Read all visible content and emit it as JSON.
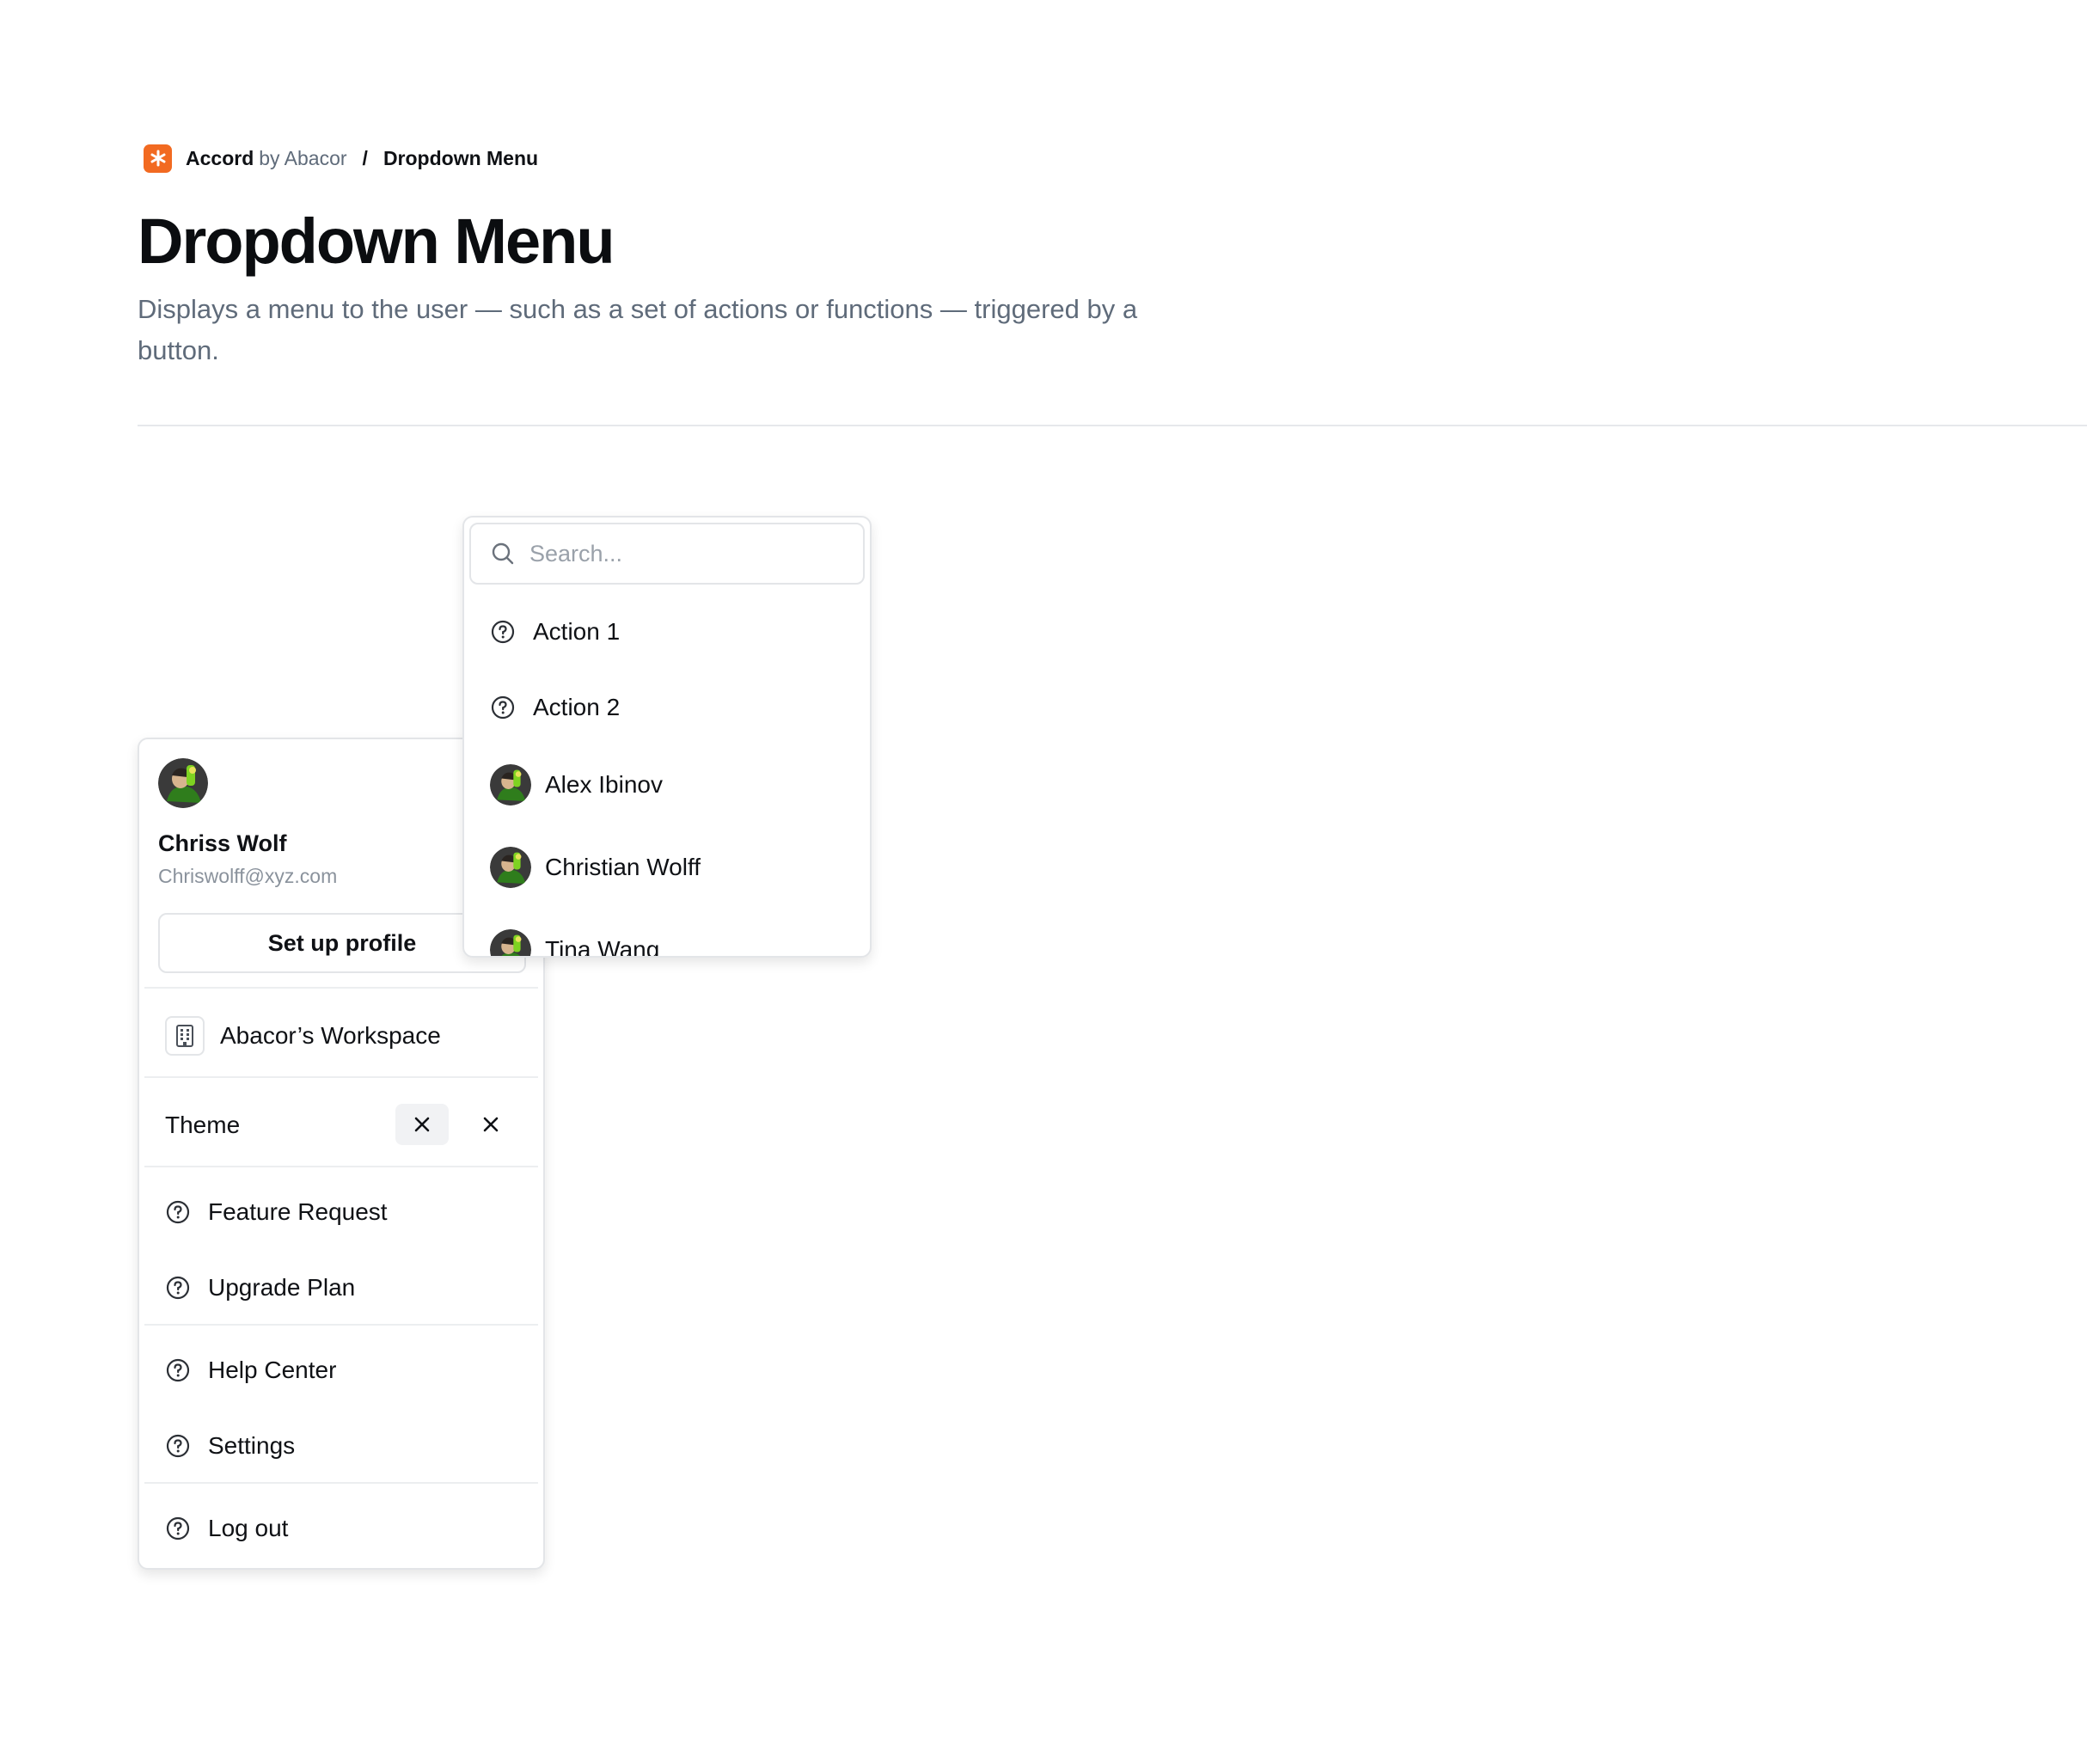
{
  "breadcrumb": {
    "brand": "Accord",
    "by": "by Abacor",
    "separator": "/",
    "current": "Dropdown Menu"
  },
  "page": {
    "title": "Dropdown Menu",
    "description": "Displays a menu to the user — such as a set of actions or functions — triggered by a button."
  },
  "account_menu": {
    "user_name": "Chriss Wolf",
    "user_email": "Chriswolff@xyz.com",
    "setup_button": "Set up profile",
    "workspace": "Abacor’s Workspace",
    "theme_label": "Theme",
    "items": [
      {
        "label": "Feature Request"
      },
      {
        "label": "Upgrade Plan"
      },
      {
        "label": "Help Center"
      },
      {
        "label": "Settings"
      },
      {
        "label": "Log out"
      }
    ]
  },
  "search_menu": {
    "placeholder": "Search...",
    "actions": [
      {
        "label": "Action 1"
      },
      {
        "label": "Action 2"
      }
    ],
    "people": [
      {
        "name": "Alex Ibinov"
      },
      {
        "name": "Christian Wolff"
      },
      {
        "name": "Tina Wang"
      }
    ]
  },
  "colors": {
    "brand_orange": "#f26a21",
    "text_primary": "#0f1115",
    "text_muted": "#5f6b7a",
    "border": "#e3e5e8"
  }
}
